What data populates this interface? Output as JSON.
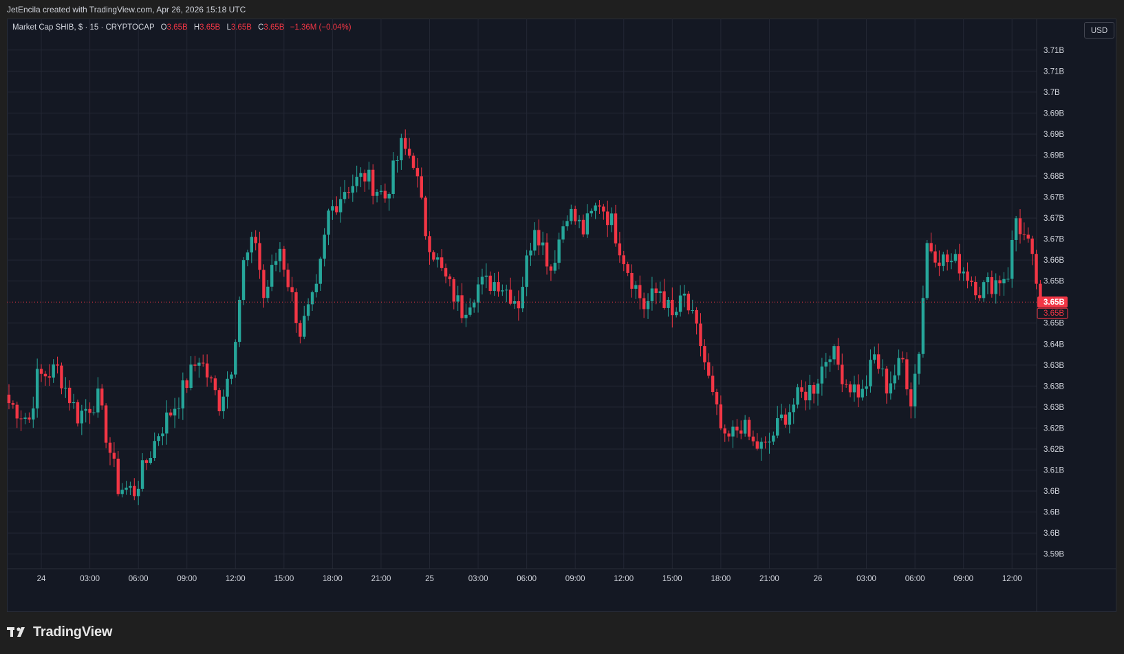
{
  "header": {
    "attribution": "JetEncila created with TradingView.com, Apr 26, 2026 15:18 UTC"
  },
  "legend": {
    "symbol": "Market Cap SHIB, $ · 15 · CRYPTOCAP",
    "open_label": "O",
    "open_value": "3.65B",
    "high_label": "H",
    "high_value": "3.65B",
    "low_label": "L",
    "low_value": "3.65B",
    "close_label": "C",
    "close_value": "3.65B",
    "change": "−1.36M (−0.04%)"
  },
  "currency_button": "USD",
  "brand": {
    "name": "TradingView",
    "logo_icon": "tradingview-logo-icon"
  },
  "colors": {
    "up": "#26a69a",
    "down": "#f23645",
    "background": "#141823",
    "grid": "#232734",
    "axis_text": "#d1d4dc"
  },
  "chart_data": {
    "type": "candlestick",
    "title": "Market Cap SHIB, $ · 15 · CRYPTOCAP",
    "interval": "15",
    "y_unit": "USD",
    "ylim": [
      3.5855,
      3.7165
    ],
    "y_ticks": [
      {
        "v": 3.709,
        "label": "3.71B"
      },
      {
        "v": 3.704,
        "label": "3.71B"
      },
      {
        "v": 3.699,
        "label": "3.7B"
      },
      {
        "v": 3.694,
        "label": "3.69B"
      },
      {
        "v": 3.689,
        "label": "3.69B"
      },
      {
        "v": 3.684,
        "label": "3.69B"
      },
      {
        "v": 3.679,
        "label": "3.68B"
      },
      {
        "v": 3.674,
        "label": "3.67B"
      },
      {
        "v": 3.669,
        "label": "3.67B"
      },
      {
        "v": 3.664,
        "label": "3.67B"
      },
      {
        "v": 3.659,
        "label": "3.66B"
      },
      {
        "v": 3.654,
        "label": "3.65B"
      },
      {
        "v": 3.644,
        "label": "3.65B"
      },
      {
        "v": 3.639,
        "label": "3.64B"
      },
      {
        "v": 3.634,
        "label": "3.63B"
      },
      {
        "v": 3.629,
        "label": "3.63B"
      },
      {
        "v": 3.624,
        "label": "3.63B"
      },
      {
        "v": 3.619,
        "label": "3.62B"
      },
      {
        "v": 3.614,
        "label": "3.62B"
      },
      {
        "v": 3.609,
        "label": "3.61B"
      },
      {
        "v": 3.604,
        "label": "3.6B"
      },
      {
        "v": 3.599,
        "label": "3.6B"
      },
      {
        "v": 3.594,
        "label": "3.6B"
      },
      {
        "v": 3.589,
        "label": "3.59B"
      }
    ],
    "x_ticks": [
      "24",
      "03:00",
      "06:00",
      "09:00",
      "12:00",
      "15:00",
      "18:00",
      "21:00",
      "25",
      "03:00",
      "06:00",
      "09:00",
      "12:00",
      "15:00",
      "18:00",
      "21:00",
      "26",
      "03:00",
      "06:00",
      "09:00",
      "12:00"
    ],
    "last_price": {
      "value": 3.649,
      "label": "3.65B"
    },
    "last_close_label": "3.65B",
    "anchors": [
      {
        "i": 0,
        "v": 3.625
      },
      {
        "i": 5,
        "v": 3.621
      },
      {
        "i": 7,
        "v": 3.631
      },
      {
        "i": 12,
        "v": 3.633
      },
      {
        "i": 17,
        "v": 3.622
      },
      {
        "i": 22,
        "v": 3.626
      },
      {
        "i": 27,
        "v": 3.605
      },
      {
        "i": 31,
        "v": 3.604
      },
      {
        "i": 37,
        "v": 3.618
      },
      {
        "i": 42,
        "v": 3.626
      },
      {
        "i": 47,
        "v": 3.636
      },
      {
        "i": 52,
        "v": 3.625
      },
      {
        "i": 55,
        "v": 3.634
      },
      {
        "i": 58,
        "v": 3.658
      },
      {
        "i": 61,
        "v": 3.664
      },
      {
        "i": 63,
        "v": 3.65
      },
      {
        "i": 67,
        "v": 3.662
      },
      {
        "i": 72,
        "v": 3.642
      },
      {
        "i": 76,
        "v": 3.651
      },
      {
        "i": 79,
        "v": 3.67
      },
      {
        "i": 83,
        "v": 3.676
      },
      {
        "i": 88,
        "v": 3.679
      },
      {
        "i": 93,
        "v": 3.674
      },
      {
        "i": 97,
        "v": 3.686
      },
      {
        "i": 100,
        "v": 3.683
      },
      {
        "i": 103,
        "v": 3.666
      },
      {
        "i": 107,
        "v": 3.656
      },
      {
        "i": 112,
        "v": 3.647
      },
      {
        "i": 116,
        "v": 3.653
      },
      {
        "i": 121,
        "v": 3.654
      },
      {
        "i": 126,
        "v": 3.649
      },
      {
        "i": 130,
        "v": 3.668
      },
      {
        "i": 134,
        "v": 3.657
      },
      {
        "i": 138,
        "v": 3.671
      },
      {
        "i": 142,
        "v": 3.666
      },
      {
        "i": 146,
        "v": 3.673
      },
      {
        "i": 149,
        "v": 3.668
      },
      {
        "i": 153,
        "v": 3.657
      },
      {
        "i": 157,
        "v": 3.648
      },
      {
        "i": 161,
        "v": 3.652
      },
      {
        "i": 164,
        "v": 3.645
      },
      {
        "i": 167,
        "v": 3.65
      },
      {
        "i": 171,
        "v": 3.639
      },
      {
        "i": 174,
        "v": 3.626
      },
      {
        "i": 177,
        "v": 3.615
      },
      {
        "i": 181,
        "v": 3.62
      },
      {
        "i": 184,
        "v": 3.615
      },
      {
        "i": 187,
        "v": 3.614
      },
      {
        "i": 191,
        "v": 3.621
      },
      {
        "i": 195,
        "v": 3.626
      },
      {
        "i": 199,
        "v": 3.629
      },
      {
        "i": 203,
        "v": 3.638
      },
      {
        "i": 207,
        "v": 3.63
      },
      {
        "i": 211,
        "v": 3.627
      },
      {
        "i": 214,
        "v": 3.636
      },
      {
        "i": 217,
        "v": 3.629
      },
      {
        "i": 221,
        "v": 3.635
      },
      {
        "i": 223,
        "v": 3.626
      },
      {
        "i": 225,
        "v": 3.638
      },
      {
        "i": 227,
        "v": 3.663
      },
      {
        "i": 231,
        "v": 3.659
      },
      {
        "i": 235,
        "v": 3.658
      },
      {
        "i": 240,
        "v": 3.652
      },
      {
        "i": 244,
        "v": 3.654
      },
      {
        "i": 247,
        "v": 3.656
      },
      {
        "i": 249,
        "v": 3.669
      },
      {
        "i": 252,
        "v": 3.662
      },
      {
        "i": 255,
        "v": 3.65
      }
    ],
    "bar_count": 256
  }
}
